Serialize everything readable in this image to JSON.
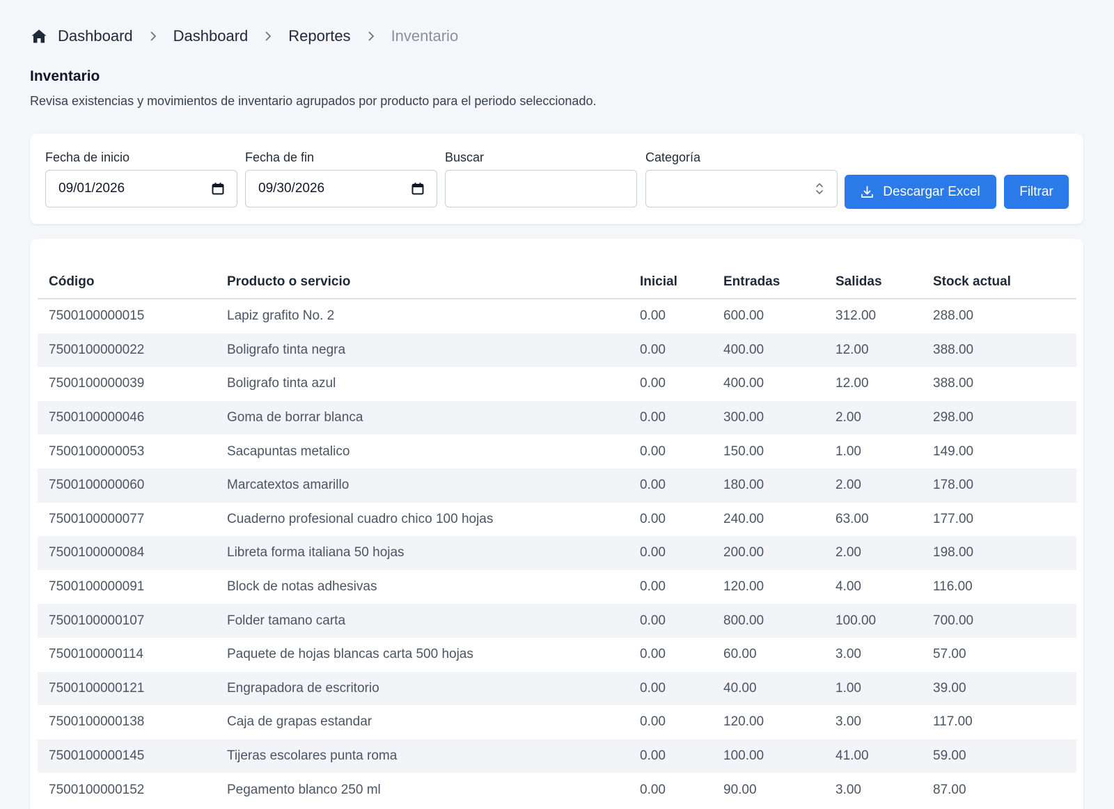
{
  "breadcrumb": {
    "items": [
      "Dashboard",
      "Dashboard",
      "Reportes"
    ],
    "current": "Inventario"
  },
  "header": {
    "title": "Inventario",
    "description": "Revisa existencias y movimientos de inventario agrupados por producto para el periodo seleccionado."
  },
  "filters": {
    "start_date_label": "Fecha de inicio",
    "start_date_value": "09/01/2026",
    "end_date_label": "Fecha de fin",
    "end_date_value": "09/30/2026",
    "search_label": "Buscar",
    "search_value": "",
    "category_label": "Categoría",
    "category_value": "",
    "download_label": "Descargar Excel",
    "filter_label": "Filtrar"
  },
  "icons": {
    "home": "home-icon",
    "separator": "chevron-right-icon",
    "calendar": "calendar-icon",
    "select": "updown-icon",
    "download": "download-icon"
  },
  "colors": {
    "accent": "#2a7be9",
    "page_background": "#f4f6f9",
    "row_stripe": "#f2f4f7"
  },
  "table": {
    "columns": [
      "Código",
      "Producto o servicio",
      "Inicial",
      "Entradas",
      "Salidas",
      "Stock actual"
    ],
    "rows": [
      [
        "7500100000015",
        "Lapiz grafito No. 2",
        "0.00",
        "600.00",
        "312.00",
        "288.00"
      ],
      [
        "7500100000022",
        "Boligrafo tinta negra",
        "0.00",
        "400.00",
        "12.00",
        "388.00"
      ],
      [
        "7500100000039",
        "Boligrafo tinta azul",
        "0.00",
        "400.00",
        "12.00",
        "388.00"
      ],
      [
        "7500100000046",
        "Goma de borrar blanca",
        "0.00",
        "300.00",
        "2.00",
        "298.00"
      ],
      [
        "7500100000053",
        "Sacapuntas metalico",
        "0.00",
        "150.00",
        "1.00",
        "149.00"
      ],
      [
        "7500100000060",
        "Marcatextos amarillo",
        "0.00",
        "180.00",
        "2.00",
        "178.00"
      ],
      [
        "7500100000077",
        "Cuaderno profesional cuadro chico 100 hojas",
        "0.00",
        "240.00",
        "63.00",
        "177.00"
      ],
      [
        "7500100000084",
        "Libreta forma italiana 50 hojas",
        "0.00",
        "200.00",
        "2.00",
        "198.00"
      ],
      [
        "7500100000091",
        "Block de notas adhesivas",
        "0.00",
        "120.00",
        "4.00",
        "116.00"
      ],
      [
        "7500100000107",
        "Folder tamano carta",
        "0.00",
        "800.00",
        "100.00",
        "700.00"
      ],
      [
        "7500100000114",
        "Paquete de hojas blancas carta 500 hojas",
        "0.00",
        "60.00",
        "3.00",
        "57.00"
      ],
      [
        "7500100000121",
        "Engrapadora de escritorio",
        "0.00",
        "40.00",
        "1.00",
        "39.00"
      ],
      [
        "7500100000138",
        "Caja de grapas estandar",
        "0.00",
        "120.00",
        "3.00",
        "117.00"
      ],
      [
        "7500100000145",
        "Tijeras escolares punta roma",
        "0.00",
        "100.00",
        "41.00",
        "59.00"
      ],
      [
        "7500100000152",
        "Pegamento blanco 250 ml",
        "0.00",
        "90.00",
        "3.00",
        "87.00"
      ]
    ]
  }
}
